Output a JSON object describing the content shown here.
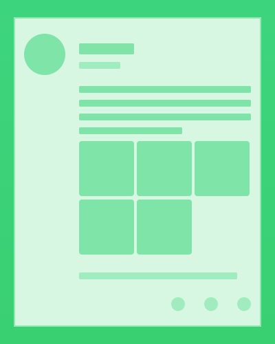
{
  "colors": {
    "background": "#3cd279",
    "card": "#d8f7e2",
    "card_border": "#8fe8b2",
    "placeholder": "#7ee4a8",
    "placeholder_light": "#a1ecbf"
  },
  "post": {
    "content_type": "loading-skeleton",
    "text_line_count": 4,
    "thumbnail_count": 5,
    "action_count": 3
  }
}
